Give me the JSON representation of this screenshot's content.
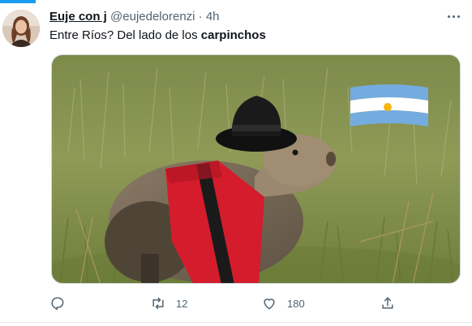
{
  "tweet": {
    "author_name": "Euje con j",
    "author_handle": "@eujedelorenzi",
    "separator": "·",
    "time": "4h",
    "text_prefix": "Entre Ríos? Del lado de los ",
    "text_bold": "carpinchos"
  },
  "media": {
    "subject": "capybara wearing black hat and red poncho with Argentine flag"
  },
  "actions": {
    "reply_icon": "reply-icon",
    "retweet_count": "12",
    "like_count": "180",
    "share_icon": "share-icon"
  },
  "colors": {
    "accent": "#1d9bf0",
    "text": "#0f1419",
    "muted": "#536471",
    "poncho_red": "#d41c2c",
    "flag_blue": "#74acdf",
    "sun_gold": "#f6b40e"
  }
}
